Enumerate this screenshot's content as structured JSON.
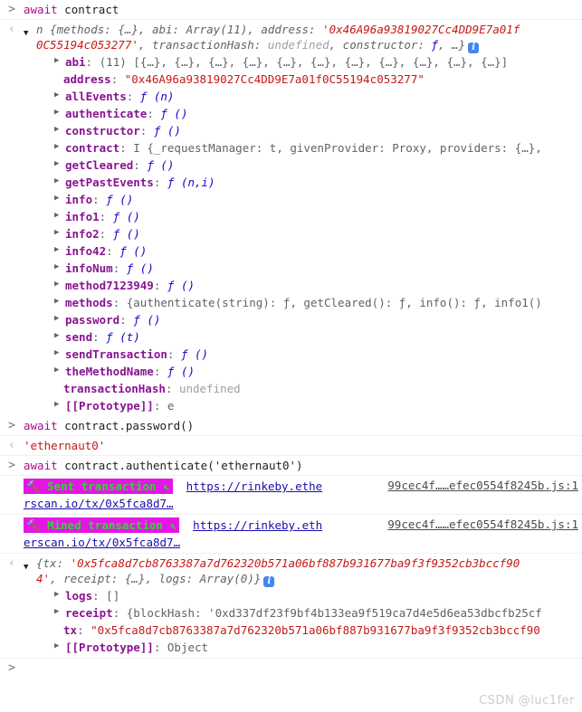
{
  "console": {
    "prompt_glyph": ">",
    "result_glyph": "‹",
    "expand_closed_glyph": "▶",
    "expand_open_glyph": "▼",
    "info_badge_label": "i"
  },
  "entries": {
    "cmd1": {
      "await": "await",
      "expr": "contract"
    },
    "result1": {
      "preview_line1_a": "n {methods: ",
      "preview_obj1": "{…}",
      "preview_line1_b": ", abi: ",
      "preview_arr": "Array(11)",
      "preview_line1_c": ", address: ",
      "address_quoted_part1": "'0x46A96a93819027Cc4DD9E7a01f",
      "address_quoted_part2": "0C55194c053277'",
      "preview_line2_a": ", transactionHash: ",
      "undefined_label": "undefined",
      "preview_line2_b": ", constructor: ",
      "fn_italic": "ƒ",
      "preview_line2_c": ", …}"
    },
    "properties": [
      {
        "arrow": true,
        "name": "abi",
        "sep": ": ",
        "value": "(11) [{…}, {…}, {…}, {…}, {…}, {…}, {…}, {…}, {…}, {…}, {…}]",
        "kind": "array"
      },
      {
        "arrow": false,
        "name": "address",
        "sep": ": ",
        "value": "\"0x46A96a93819027Cc4DD9E7a01f0C55194c053277\"",
        "kind": "string"
      },
      {
        "arrow": true,
        "name": "allEvents",
        "sep": ": ",
        "value": "ƒ (n)",
        "kind": "function"
      },
      {
        "arrow": true,
        "name": "authenticate",
        "sep": ": ",
        "value": "ƒ ()",
        "kind": "function"
      },
      {
        "arrow": true,
        "name": "constructor",
        "sep": ": ",
        "value": "ƒ ()",
        "kind": "function"
      },
      {
        "arrow": true,
        "name": "contract",
        "sep": ": ",
        "value": "I {_requestManager: t, givenProvider: Proxy, providers: {…},",
        "kind": "object"
      },
      {
        "arrow": true,
        "name": "getCleared",
        "sep": ": ",
        "value": "ƒ ()",
        "kind": "function"
      },
      {
        "arrow": true,
        "name": "getPastEvents",
        "sep": ": ",
        "value": "ƒ (n,i)",
        "kind": "function"
      },
      {
        "arrow": true,
        "name": "info",
        "sep": ": ",
        "value": "ƒ ()",
        "kind": "function"
      },
      {
        "arrow": true,
        "name": "info1",
        "sep": ": ",
        "value": "ƒ ()",
        "kind": "function"
      },
      {
        "arrow": true,
        "name": "info2",
        "sep": ": ",
        "value": "ƒ ()",
        "kind": "function"
      },
      {
        "arrow": true,
        "name": "info42",
        "sep": ": ",
        "value": "ƒ ()",
        "kind": "function"
      },
      {
        "arrow": true,
        "name": "infoNum",
        "sep": ": ",
        "value": "ƒ ()",
        "kind": "function"
      },
      {
        "arrow": true,
        "name": "method7123949",
        "sep": ": ",
        "value": "ƒ ()",
        "kind": "function"
      },
      {
        "arrow": true,
        "name": "methods",
        "sep": ": ",
        "value": "{authenticate(string): ƒ, getCleared(): ƒ, info(): ƒ, info1()",
        "kind": "object"
      },
      {
        "arrow": true,
        "name": "password",
        "sep": ": ",
        "value": "ƒ ()",
        "kind": "function"
      },
      {
        "arrow": true,
        "name": "send",
        "sep": ": ",
        "value": "ƒ (t)",
        "kind": "function"
      },
      {
        "arrow": true,
        "name": "sendTransaction",
        "sep": ": ",
        "value": "ƒ ()",
        "kind": "function"
      },
      {
        "arrow": true,
        "name": "theMethodName",
        "sep": ": ",
        "value": "ƒ ()",
        "kind": "function"
      },
      {
        "arrow": false,
        "name": "transactionHash",
        "sep": ": ",
        "value": "undefined",
        "kind": "undefined"
      },
      {
        "arrow": true,
        "name": "[[Prototype]]",
        "sep": ": ",
        "value": "e",
        "kind": "proto"
      }
    ],
    "cmd2": {
      "await": "await",
      "expr": "contract.password()"
    },
    "result2": {
      "value": "'ethernaut0'"
    },
    "cmd3": {
      "await": "await",
      "expr": "contract.authenticate('ethernaut0')"
    },
    "tx_sent": {
      "hammer_left": "🔨",
      "label": "Sent transaction",
      "hammer_right": "↖",
      "url_part1": "https://rinkeby.ethe",
      "url_part2": "rscan.io/tx/0x5fca8d7…",
      "source": "99cec4f……efec0554f8245b.js:1"
    },
    "tx_mined": {
      "hammer_left": "🔨",
      "label": "Mined transaction",
      "hammer_right": "↖",
      "url_part1": "https://rinkeby.eth",
      "url_part2": "erscan.io/tx/0x5fca8d7…",
      "source": "99cec4f……efec0554f8245b.js:1"
    },
    "result3": {
      "prefix": "{tx: ",
      "tx_part1": "'0x5fca8d7cb8763387a7d762320b571a06bf887b931677ba9f3f9352cb3bccf90",
      "tx_part2": "4'",
      "mid": ", receipt: ",
      "receipt_obj": "{…}",
      "logs_label": ", logs: ",
      "logs_value": "Array(0)",
      "suffix": "}"
    },
    "result3_properties": [
      {
        "arrow": true,
        "name": "logs",
        "sep": ": ",
        "value": "[]",
        "kind": "array"
      },
      {
        "arrow": true,
        "name": "receipt",
        "sep": ": ",
        "value": "{blockHash: '0xd337df23f9bf4b133ea9f519ca7d4e5d6ea53dbcfb25cf",
        "kind": "object"
      },
      {
        "arrow": false,
        "name": "tx",
        "sep": ": ",
        "value": "\"0x5fca8d7cb8763387a7d762320b571a06bf887b931677ba9f3f9352cb3bccf90",
        "kind": "string"
      },
      {
        "arrow": true,
        "name": "[[Prototype]]",
        "sep": ": ",
        "value": "Object",
        "kind": "proto"
      }
    ]
  },
  "watermark": {
    "text": "CSDN @luc1fer"
  },
  "colors": {
    "badge_background": "#e416e4",
    "badge_text": "#2bdb2b",
    "string_token": "#c41a16",
    "property_token": "#881391",
    "keyword_token": "#aa0d91",
    "link": "#1a0dab",
    "info_badge": "#4285f4"
  }
}
